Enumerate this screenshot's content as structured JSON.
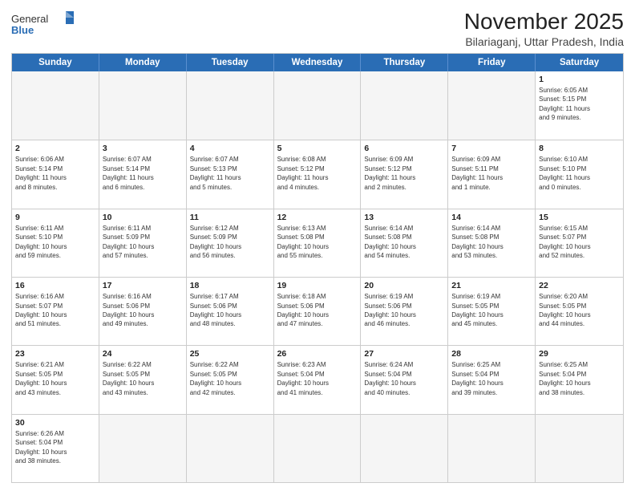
{
  "header": {
    "logo_general": "General",
    "logo_blue": "Blue",
    "month_title": "November 2025",
    "location": "Bilariaganj, Uttar Pradesh, India"
  },
  "day_headers": [
    "Sunday",
    "Monday",
    "Tuesday",
    "Wednesday",
    "Thursday",
    "Friday",
    "Saturday"
  ],
  "weeks": [
    [
      {
        "day": "",
        "empty": true
      },
      {
        "day": "",
        "empty": true
      },
      {
        "day": "",
        "empty": true
      },
      {
        "day": "",
        "empty": true
      },
      {
        "day": "",
        "empty": true
      },
      {
        "day": "",
        "empty": true
      },
      {
        "day": "1",
        "info": "Sunrise: 6:05 AM\nSunset: 5:15 PM\nDaylight: 11 hours\nand 9 minutes."
      }
    ],
    [
      {
        "day": "2",
        "info": "Sunrise: 6:06 AM\nSunset: 5:14 PM\nDaylight: 11 hours\nand 8 minutes."
      },
      {
        "day": "3",
        "info": "Sunrise: 6:07 AM\nSunset: 5:14 PM\nDaylight: 11 hours\nand 6 minutes."
      },
      {
        "day": "4",
        "info": "Sunrise: 6:07 AM\nSunset: 5:13 PM\nDaylight: 11 hours\nand 5 minutes."
      },
      {
        "day": "5",
        "info": "Sunrise: 6:08 AM\nSunset: 5:12 PM\nDaylight: 11 hours\nand 4 minutes."
      },
      {
        "day": "6",
        "info": "Sunrise: 6:09 AM\nSunset: 5:12 PM\nDaylight: 11 hours\nand 2 minutes."
      },
      {
        "day": "7",
        "info": "Sunrise: 6:09 AM\nSunset: 5:11 PM\nDaylight: 11 hours\nand 1 minute."
      },
      {
        "day": "8",
        "info": "Sunrise: 6:10 AM\nSunset: 5:10 PM\nDaylight: 11 hours\nand 0 minutes."
      }
    ],
    [
      {
        "day": "9",
        "info": "Sunrise: 6:11 AM\nSunset: 5:10 PM\nDaylight: 10 hours\nand 59 minutes."
      },
      {
        "day": "10",
        "info": "Sunrise: 6:11 AM\nSunset: 5:09 PM\nDaylight: 10 hours\nand 57 minutes."
      },
      {
        "day": "11",
        "info": "Sunrise: 6:12 AM\nSunset: 5:09 PM\nDaylight: 10 hours\nand 56 minutes."
      },
      {
        "day": "12",
        "info": "Sunrise: 6:13 AM\nSunset: 5:08 PM\nDaylight: 10 hours\nand 55 minutes."
      },
      {
        "day": "13",
        "info": "Sunrise: 6:14 AM\nSunset: 5:08 PM\nDaylight: 10 hours\nand 54 minutes."
      },
      {
        "day": "14",
        "info": "Sunrise: 6:14 AM\nSunset: 5:08 PM\nDaylight: 10 hours\nand 53 minutes."
      },
      {
        "day": "15",
        "info": "Sunrise: 6:15 AM\nSunset: 5:07 PM\nDaylight: 10 hours\nand 52 minutes."
      }
    ],
    [
      {
        "day": "16",
        "info": "Sunrise: 6:16 AM\nSunset: 5:07 PM\nDaylight: 10 hours\nand 51 minutes."
      },
      {
        "day": "17",
        "info": "Sunrise: 6:16 AM\nSunset: 5:06 PM\nDaylight: 10 hours\nand 49 minutes."
      },
      {
        "day": "18",
        "info": "Sunrise: 6:17 AM\nSunset: 5:06 PM\nDaylight: 10 hours\nand 48 minutes."
      },
      {
        "day": "19",
        "info": "Sunrise: 6:18 AM\nSunset: 5:06 PM\nDaylight: 10 hours\nand 47 minutes."
      },
      {
        "day": "20",
        "info": "Sunrise: 6:19 AM\nSunset: 5:06 PM\nDaylight: 10 hours\nand 46 minutes."
      },
      {
        "day": "21",
        "info": "Sunrise: 6:19 AM\nSunset: 5:05 PM\nDaylight: 10 hours\nand 45 minutes."
      },
      {
        "day": "22",
        "info": "Sunrise: 6:20 AM\nSunset: 5:05 PM\nDaylight: 10 hours\nand 44 minutes."
      }
    ],
    [
      {
        "day": "23",
        "info": "Sunrise: 6:21 AM\nSunset: 5:05 PM\nDaylight: 10 hours\nand 43 minutes."
      },
      {
        "day": "24",
        "info": "Sunrise: 6:22 AM\nSunset: 5:05 PM\nDaylight: 10 hours\nand 43 minutes."
      },
      {
        "day": "25",
        "info": "Sunrise: 6:22 AM\nSunset: 5:05 PM\nDaylight: 10 hours\nand 42 minutes."
      },
      {
        "day": "26",
        "info": "Sunrise: 6:23 AM\nSunset: 5:04 PM\nDaylight: 10 hours\nand 41 minutes."
      },
      {
        "day": "27",
        "info": "Sunrise: 6:24 AM\nSunset: 5:04 PM\nDaylight: 10 hours\nand 40 minutes."
      },
      {
        "day": "28",
        "info": "Sunrise: 6:25 AM\nSunset: 5:04 PM\nDaylight: 10 hours\nand 39 minutes."
      },
      {
        "day": "29",
        "info": "Sunrise: 6:25 AM\nSunset: 5:04 PM\nDaylight: 10 hours\nand 38 minutes."
      }
    ],
    [
      {
        "day": "30",
        "info": "Sunrise: 6:26 AM\nSunset: 5:04 PM\nDaylight: 10 hours\nand 38 minutes."
      },
      {
        "day": "",
        "empty": true
      },
      {
        "day": "",
        "empty": true
      },
      {
        "day": "",
        "empty": true
      },
      {
        "day": "",
        "empty": true
      },
      {
        "day": "",
        "empty": true
      },
      {
        "day": "",
        "empty": true
      }
    ]
  ]
}
